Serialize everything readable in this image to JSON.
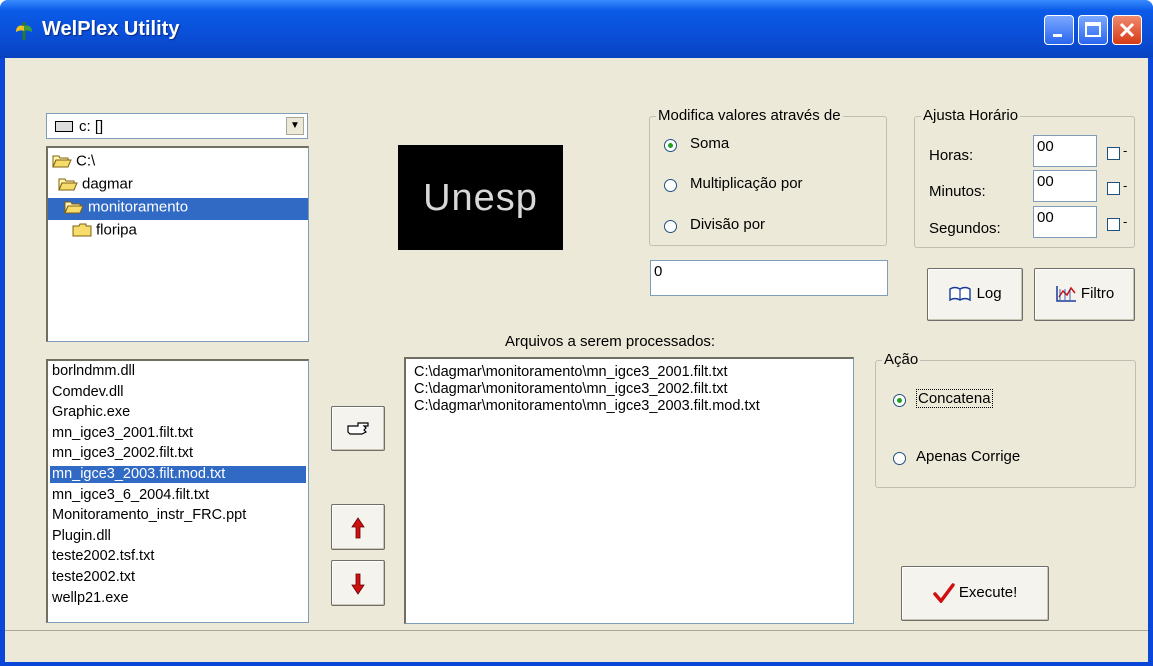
{
  "window": {
    "title": "WelPlex Utility"
  },
  "drive": {
    "value": "c: []"
  },
  "folders": [
    {
      "label": "C:\\",
      "indent": 0,
      "selected": false,
      "icon": "open-folder-icon"
    },
    {
      "label": "dagmar",
      "indent": 1,
      "selected": false,
      "icon": "open-folder-icon"
    },
    {
      "label": "monitoramento",
      "indent": 2,
      "selected": true,
      "icon": "open-folder-icon"
    },
    {
      "label": "floripa",
      "indent": 3,
      "selected": false,
      "icon": "folder-icon"
    }
  ],
  "files": [
    "borlndmm.dll",
    "Comdev.dll",
    "Graphic.exe",
    "mn_igce3_2001.filt.txt",
    "mn_igce3_2002.filt.txt",
    "mn_igce3_2003.filt.mod.txt",
    "mn_igce3_6_2004.filt.txt",
    "Monitoramento_instr_FRC.ppt",
    "Plugin.dll",
    "teste2002.tsf.txt",
    "teste2002.txt",
    "wellp21.exe"
  ],
  "selected_file_index": 5,
  "logo": {
    "text": "Unesp"
  },
  "modifica": {
    "title": "Modifica valores através de",
    "options": [
      "Soma",
      "Multiplicação por",
      "Divisão por"
    ],
    "selected": 0,
    "value": "0"
  },
  "ajusta": {
    "title": "Ajusta Horário",
    "rows": [
      {
        "label": "Horas:",
        "value": "00"
      },
      {
        "label": "Minutos:",
        "value": "00"
      },
      {
        "label": "Segundos:",
        "value": "00"
      }
    ],
    "suffix": "-"
  },
  "buttons": {
    "log": "Log",
    "filtro": "Filtro",
    "execute": "Execute!"
  },
  "processed": {
    "label": "Arquivos a serem processados:",
    "items": [
      "C:\\dagmar\\monitoramento\\mn_igce3_2001.filt.txt",
      "C:\\dagmar\\monitoramento\\mn_igce3_2002.filt.txt",
      "C:\\dagmar\\monitoramento\\mn_igce3_2003.filt.mod.txt"
    ]
  },
  "acao": {
    "title": "Ação",
    "options": [
      "Concatena",
      "Apenas Corrige"
    ],
    "selected": 0
  },
  "colors": {
    "title_bar": "#0a4fd8",
    "selection": "#316ac5",
    "window_bg": "#ece9d8"
  }
}
